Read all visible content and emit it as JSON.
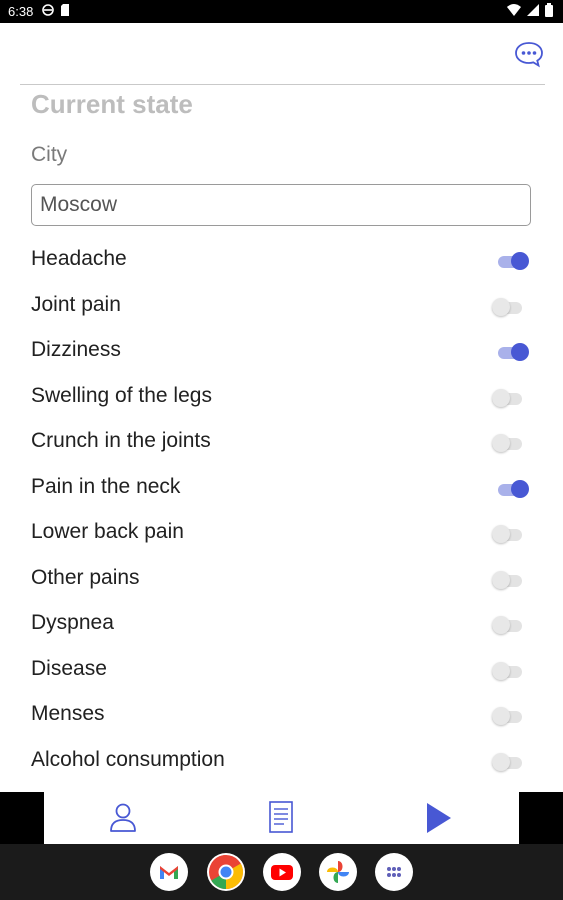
{
  "status_bar": {
    "time": "6:38",
    "left_icons": [
      "vpn-key-icon",
      "storage-icon"
    ],
    "right_icons": [
      "wifi-icon",
      "signal-icon",
      "battery-icon"
    ]
  },
  "header": {
    "chat_icon": "chat-bubble-icon"
  },
  "form": {
    "title": "Current state",
    "city_label": "City",
    "city_value": "Moscow"
  },
  "symptoms": [
    {
      "label": "Headache",
      "on": true
    },
    {
      "label": "Joint pain",
      "on": false
    },
    {
      "label": "Dizziness",
      "on": true
    },
    {
      "label": "Swelling of the legs",
      "on": false
    },
    {
      "label": "Crunch in the joints",
      "on": false
    },
    {
      "label": "Pain in the neck",
      "on": true
    },
    {
      "label": "Lower back pain",
      "on": false
    },
    {
      "label": "Other pains",
      "on": false
    },
    {
      "label": "Dyspnea",
      "on": false
    },
    {
      "label": "Disease",
      "on": false
    },
    {
      "label": "Menses",
      "on": false
    },
    {
      "label": "Alcohol consumption",
      "on": false
    }
  ],
  "bottom_nav": [
    "person-icon",
    "document-icon",
    "play-icon"
  ],
  "dock": [
    "gmail-icon",
    "chrome-icon",
    "youtube-icon",
    "photos-icon",
    "app-drawer-icon"
  ],
  "colors": {
    "accent": "#4858d4",
    "title_gray": "#bdbdbd"
  }
}
